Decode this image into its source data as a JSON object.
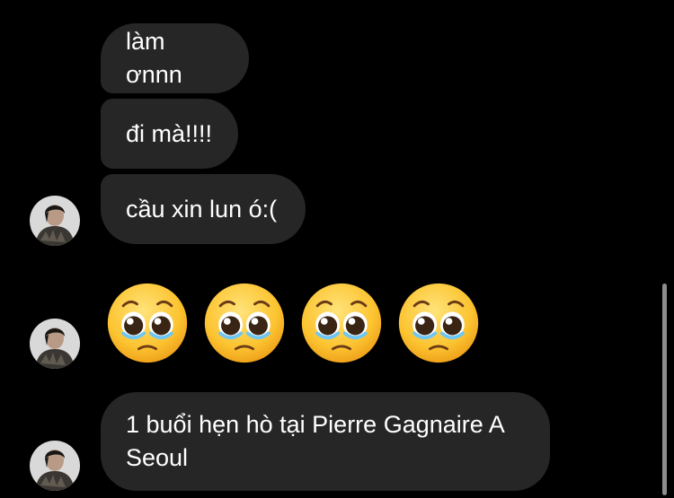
{
  "messages": [
    {
      "text": "làm ơnnn"
    },
    {
      "text": "đi mà!!!!"
    },
    {
      "text": "cầu xin lun ó:("
    },
    {
      "text": "1 buổi hẹn hò tại Pierre Gagnaire A Seoul"
    }
  ],
  "emoji_message": {
    "emojis": [
      "pleading-face",
      "pleading-face",
      "pleading-face",
      "pleading-face"
    ]
  },
  "colors": {
    "background": "#000000",
    "bubble": "#262626",
    "text": "#ffffff",
    "scrollbar": "#8e8e8e"
  }
}
